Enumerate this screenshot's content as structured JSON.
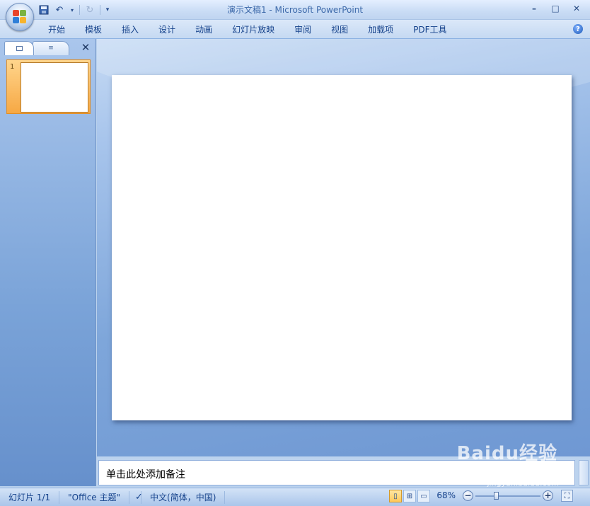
{
  "titlebar": {
    "title": "演示文稿1 - Microsoft PowerPoint",
    "quick_access": [
      {
        "name": "save-icon"
      },
      {
        "name": "undo-icon"
      },
      {
        "name": "redo-icon"
      }
    ],
    "window_controls": {
      "minimize": "–",
      "maximize": "□",
      "close": "✕"
    }
  },
  "ribbon": {
    "tabs": [
      {
        "label": "开始"
      },
      {
        "label": "模板"
      },
      {
        "label": "插入"
      },
      {
        "label": "设计"
      },
      {
        "label": "动画"
      },
      {
        "label": "幻灯片放映"
      },
      {
        "label": "审阅"
      },
      {
        "label": "视图"
      },
      {
        "label": "加载项"
      },
      {
        "label": "PDF工具"
      }
    ],
    "help": "?"
  },
  "slides_pane": {
    "close": "✕",
    "slides": [
      {
        "number": "1"
      }
    ]
  },
  "notes": {
    "placeholder": "单击此处添加备注"
  },
  "status_bar": {
    "slide_info": "幻灯片 1/1",
    "theme": "\"Office 主题\"",
    "language": "中文(简体，中国)",
    "zoom": "68%",
    "zoom_level_percent": 68
  },
  "watermark": {
    "text": "Baidu经验",
    "sub": "jingyan.baidu.com"
  },
  "colors": {
    "accent_selected": "#f6a844",
    "ribbon_bg": "#c5d9f2",
    "workspace_bg": "#7ea6da"
  }
}
